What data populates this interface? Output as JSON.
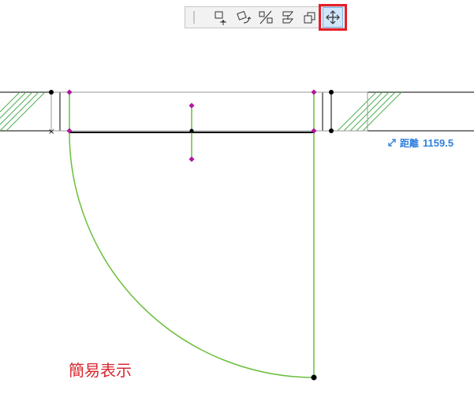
{
  "toolbar": {
    "buttons": [
      {
        "name": "separator",
        "icon": "separator-icon"
      },
      {
        "name": "drag",
        "icon": "drag-icon"
      },
      {
        "name": "rotate",
        "icon": "rotate-icon"
      },
      {
        "name": "mirror",
        "icon": "mirror-icon"
      },
      {
        "name": "elevate",
        "icon": "elevate-icon"
      },
      {
        "name": "multiply",
        "icon": "multiply-icon"
      },
      {
        "name": "offset",
        "icon": "move-cross-icon",
        "active": true
      }
    ]
  },
  "readout": {
    "icon": "resize-arrow-icon",
    "label": "距離",
    "value": "1159.5"
  },
  "caption": "簡易表示",
  "colors": {
    "door": "#6abf3c",
    "node": "#b0169e",
    "wall": "#000000",
    "hatch": "#4caf50",
    "readout": "#2f7fe0",
    "caption": "#d8282f",
    "highlight": "#e6202a"
  }
}
